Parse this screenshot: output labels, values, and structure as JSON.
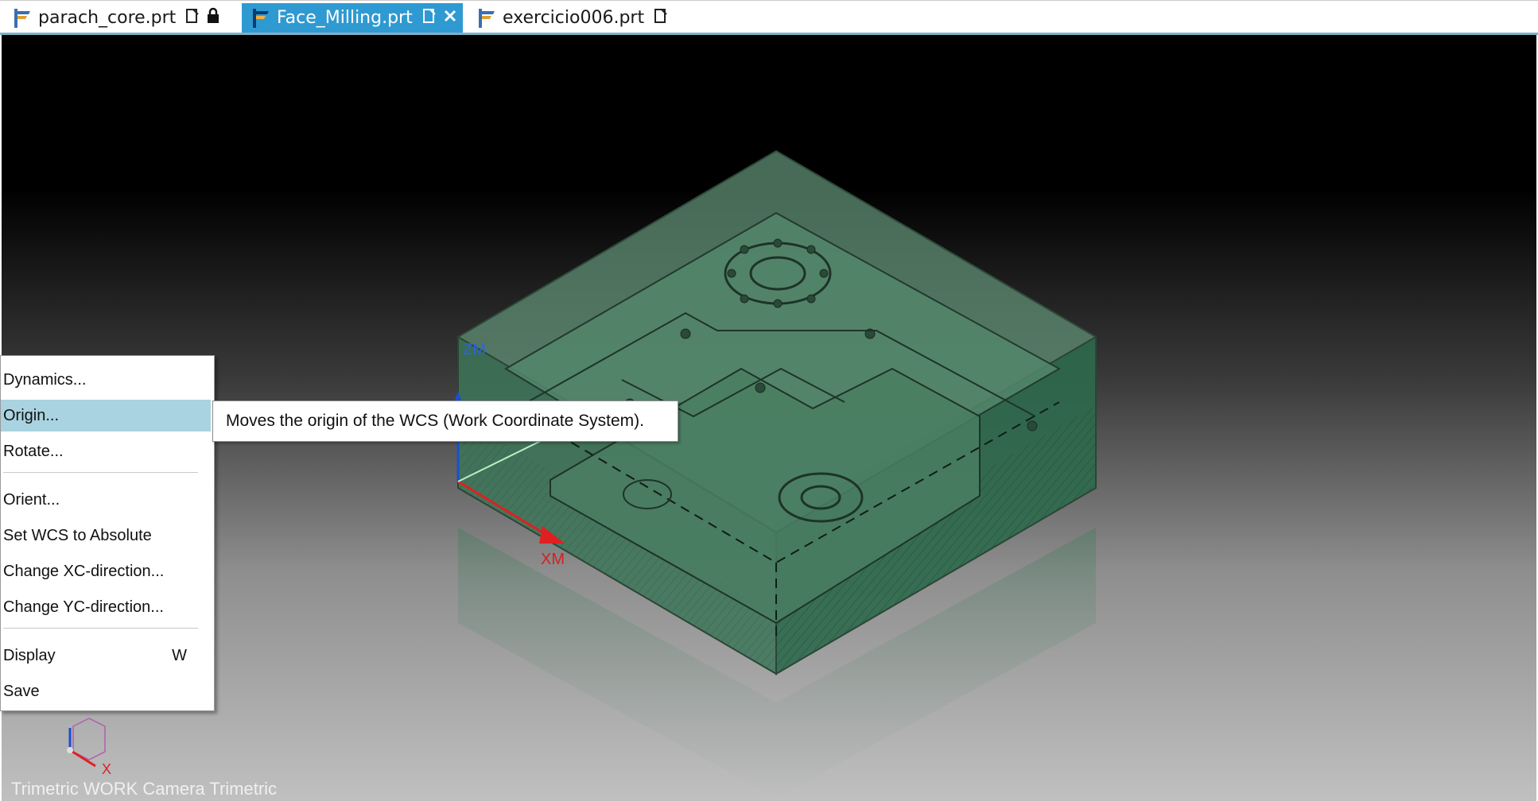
{
  "tabs": [
    {
      "label": "parach_core.prt",
      "active": false
    },
    {
      "label": "Face_Milling.prt",
      "active": true
    },
    {
      "label": "exercicio006.prt",
      "active": false
    }
  ],
  "tab_icons": {
    "file": "nx-part-icon",
    "status": "file-status-icon",
    "lock": "lock-icon",
    "close": "close-icon"
  },
  "viewport": {
    "view_label": "Trimetric WORK Camera Trimetric",
    "axis_labels": {
      "zm": "ZM",
      "xm": "XM",
      "x": "X"
    }
  },
  "context_menu": {
    "items": [
      {
        "label": "Dynamics...",
        "selected": false
      },
      {
        "label": "Origin...",
        "selected": true
      },
      {
        "label": "Rotate...",
        "selected": false
      },
      {
        "label": "Orient...",
        "selected": false
      },
      {
        "label": "Set WCS to Absolute",
        "selected": false
      },
      {
        "label": "Change XC-direction...",
        "selected": false
      },
      {
        "label": "Change YC-direction...",
        "selected": false
      },
      {
        "label": "Display",
        "shortcut": "W",
        "selected": false
      },
      {
        "label": "Save",
        "selected": false
      }
    ]
  },
  "tooltip": {
    "text": "Moves the origin of the WCS (Work Coordinate System)."
  },
  "colors": {
    "accent": "#2f9ad1",
    "model_green": "#2e6a4c",
    "menu_highlight": "#a9d3e0",
    "xm_axis": "#e02020",
    "zm_axis": "#1a4fd0"
  }
}
